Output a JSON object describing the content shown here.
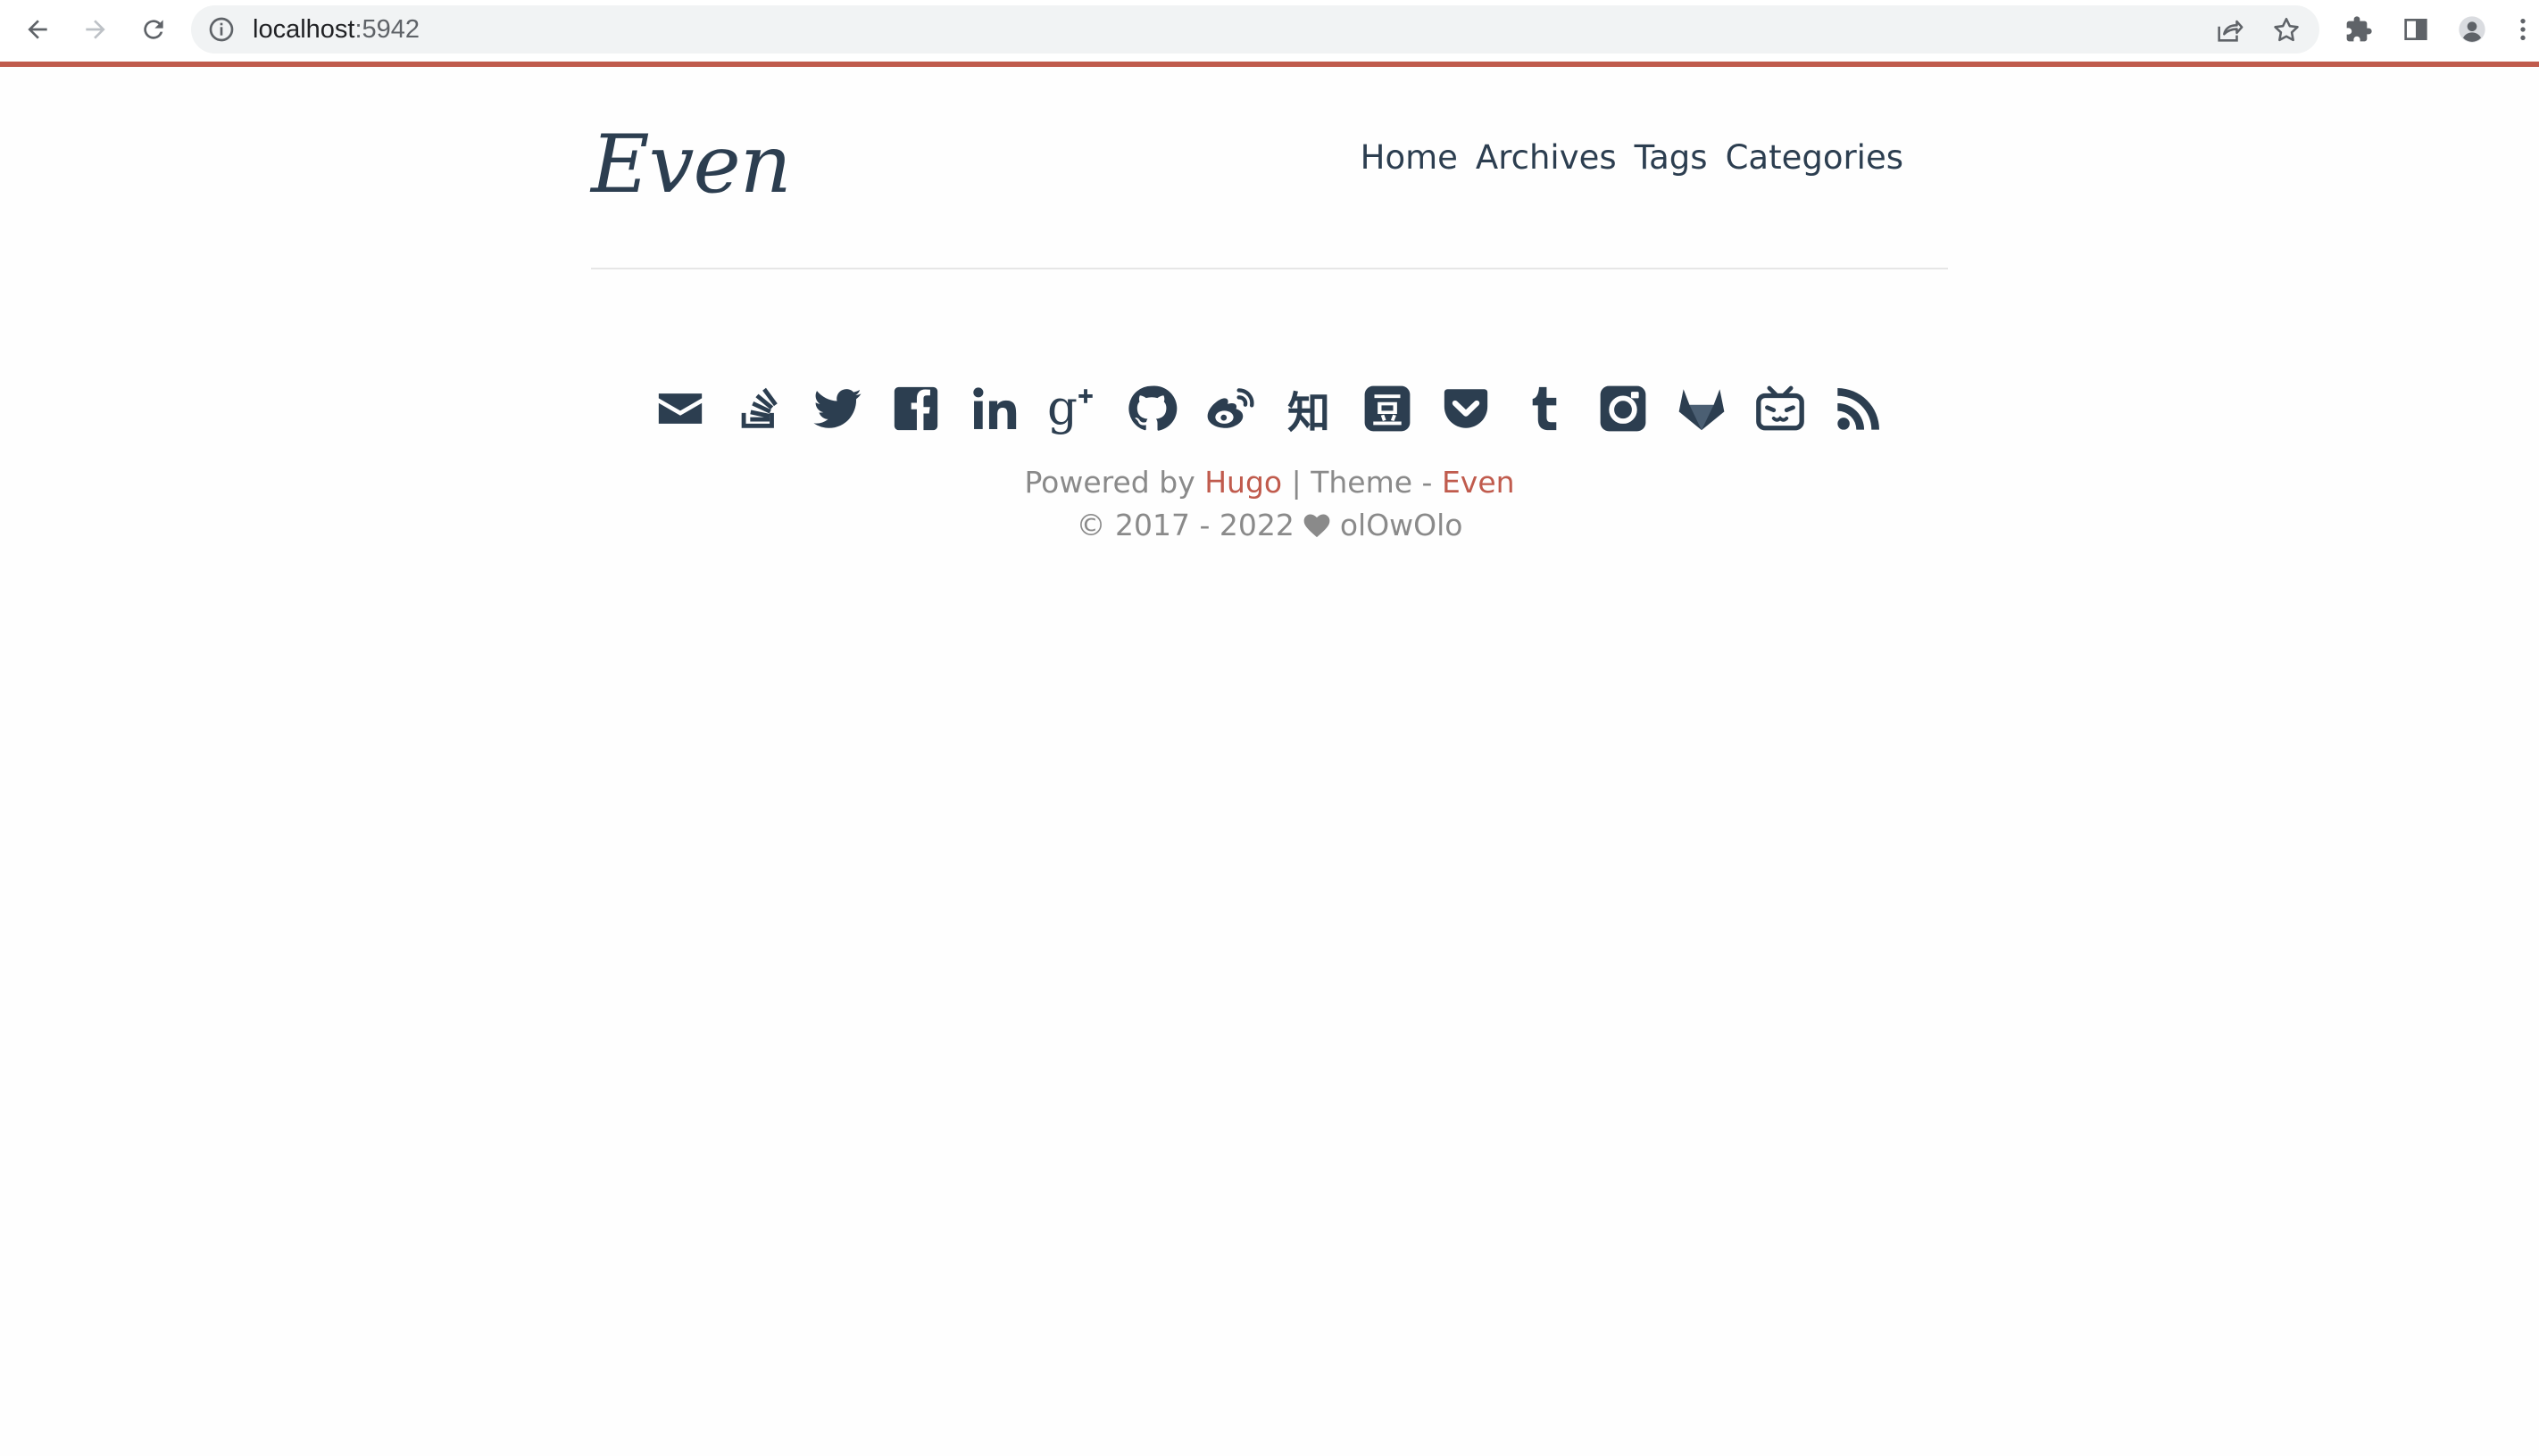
{
  "browser": {
    "url_host": "localhost",
    "url_port": ":5942",
    "accent_color": "#c05b4d"
  },
  "site": {
    "logo": "Even",
    "nav": [
      "Home",
      "Archives",
      "Tags",
      "Categories"
    ]
  },
  "social_icons": [
    "email-icon",
    "stack-overflow-icon",
    "twitter-icon",
    "facebook-icon",
    "linkedin-icon",
    "google-plus-icon",
    "github-icon",
    "weibo-icon",
    "zhihu-icon",
    "douban-icon",
    "pocket-icon",
    "tumblr-icon",
    "instagram-icon",
    "gitlab-icon",
    "bilibili-icon",
    "rss-icon"
  ],
  "zhihu_glyph": "知",
  "douban_glyph": "豆",
  "footer": {
    "powered_prefix": "Powered by",
    "hugo": "Hugo",
    "theme_sep": "| Theme -",
    "theme": "Even",
    "copyright_years": "© 2017 - 2022",
    "author": "olOwOlo"
  }
}
